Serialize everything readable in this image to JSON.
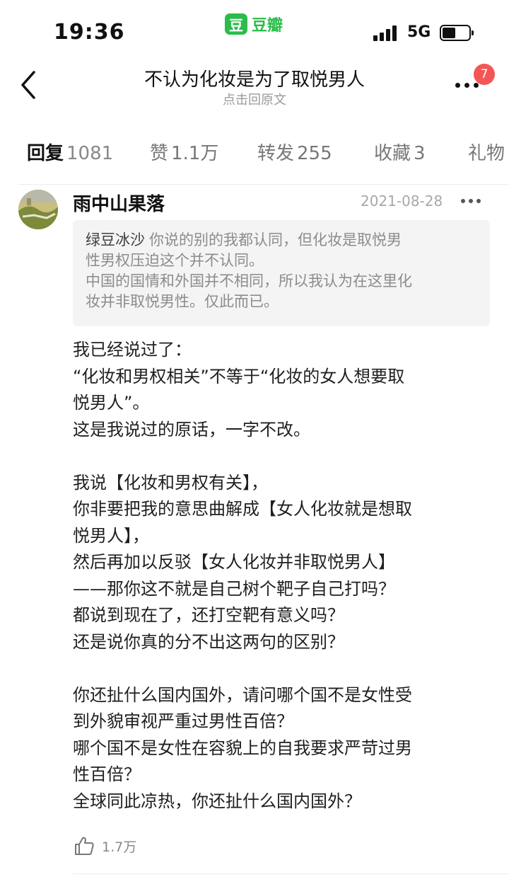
{
  "status": {
    "time": "19:36",
    "network": "5G",
    "app_logo": "豆",
    "app_name": "豆瓣"
  },
  "nav": {
    "title": "不认为化妆是为了取悦男人",
    "subtitle": "点击回原文",
    "notification_count": "7"
  },
  "tabs": [
    {
      "label": "回复",
      "count": "1081",
      "active": true
    },
    {
      "label": "赞",
      "count": "1.1万"
    },
    {
      "label": "转发",
      "count": "255"
    },
    {
      "label": "收藏",
      "count": "3"
    },
    {
      "label": "礼物",
      "count": ""
    }
  ],
  "comment": {
    "author": "雨中山果落",
    "date": "2021-08-28",
    "quote": {
      "author": "绿豆冰沙",
      "line1": "你说的别的我都认同，但化妆是取悦男",
      "line2": "性男权压迫这个并不认同。",
      "line3": "中国的国情和外国并不相同，所以我认为在这里化",
      "line4": "妆并非取悦男性。仅此而已。"
    },
    "lines": [
      "我已经说过了：",
      "“化妆和男权相关”不等于“化妆的女人想要取",
      "悦男人”。",
      "这是我说过的原话，一字不改。",
      "",
      "我说【化妆和男权有关】，",
      "你非要把我的意思曲解成【女人化妆就是想取",
      "悦男人】，",
      "然后再加以反驳【女人化妆并非取悦男人】",
      "——那你这不就是自己树个靶子自己打吗？",
      "都说到现在了，还打空靶有意义吗？",
      "还是说你真的分不出这两句的区别？",
      "",
      "你还扯什么国内国外，请问哪个国不是女性受",
      "到外貌审视严重过男性百倍？",
      "哪个国不是女性在容貌上的自我要求严苛过男",
      "性百倍？",
      "全球同此凉热，你还扯什么国内国外？"
    ],
    "likes": "1.7万"
  },
  "icons": {
    "back": "chevron-left-icon",
    "more": "more-dots-icon",
    "like": "thumbs-up-icon"
  },
  "colors": {
    "brand": "#2bbd4b",
    "badge": "#f25656"
  }
}
